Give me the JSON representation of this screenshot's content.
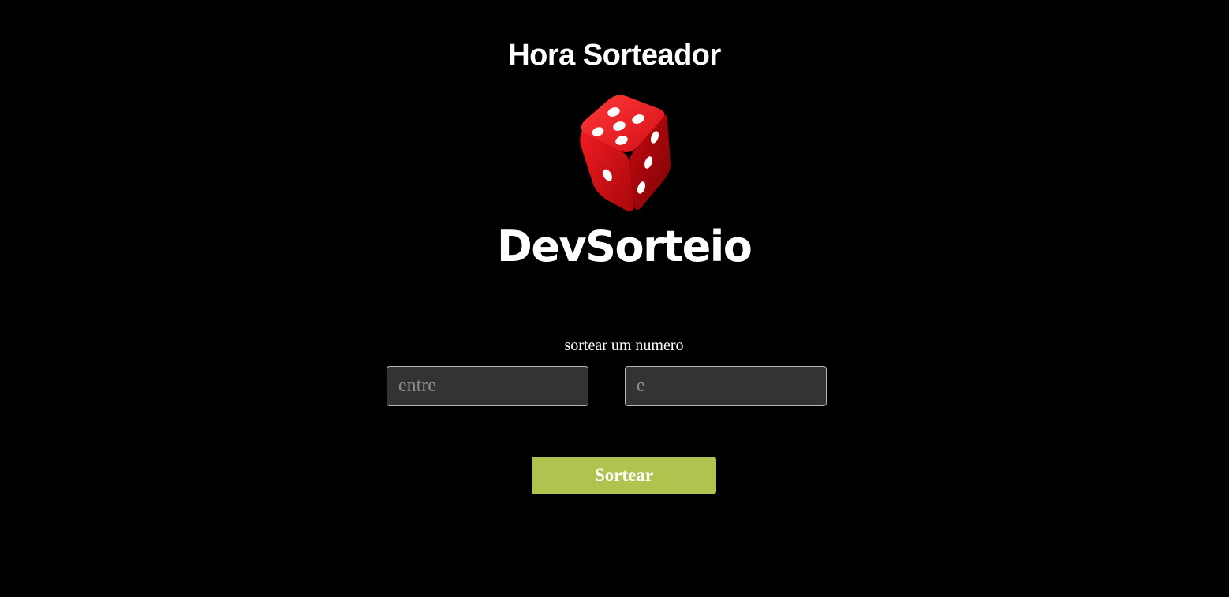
{
  "header": {
    "title": "Hora Sorteador"
  },
  "logo": {
    "icon": "dice-icon",
    "brand_text": "DevSorteio",
    "dice_color": "#e0141b"
  },
  "form": {
    "label": "sortear um numero",
    "min_input": {
      "value": "",
      "placeholder": "entre"
    },
    "max_input": {
      "value": "",
      "placeholder": "e"
    },
    "submit_label": "Sortear"
  },
  "colors": {
    "background": "#000000",
    "input_background": "#333333",
    "button": "#b1c34e",
    "text": "#ffffff"
  }
}
